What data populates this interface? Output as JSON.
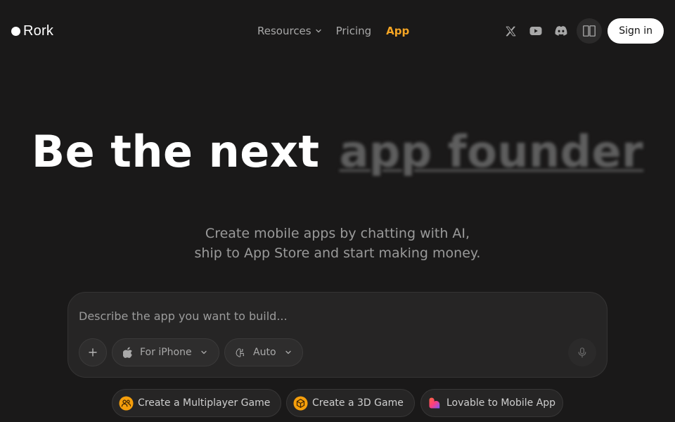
{
  "brand": {
    "name": "Rork"
  },
  "nav": {
    "resources": "Resources",
    "pricing": "Pricing",
    "app": "App"
  },
  "header_icons": [
    "x-twitter-icon",
    "youtube-icon",
    "discord-icon",
    "panel-toggle-icon"
  ],
  "auth": {
    "signin_label": "Sign in"
  },
  "hero": {
    "title_static": "Be the next",
    "title_rotating": "app founder",
    "subtitle_line1": "Create mobile apps by chatting with AI,",
    "subtitle_line2": "ship to App Store and start making money."
  },
  "prompt": {
    "placeholder": "Describe the app you want to build...",
    "value": "",
    "device_label": "For iPhone",
    "model_label": "Auto"
  },
  "suggestions": [
    {
      "label": "Create a Multiplayer Game",
      "icon": "multiplayer-icon"
    },
    {
      "label": "Create a 3D Game",
      "icon": "cube-icon"
    },
    {
      "label": "Lovable to Mobile App",
      "icon": "lovable-heart-icon"
    }
  ],
  "colors": {
    "background": "#1a1919",
    "accent": "#f5a524",
    "nav_text": "#a8a8a8",
    "surface": "#262525"
  }
}
